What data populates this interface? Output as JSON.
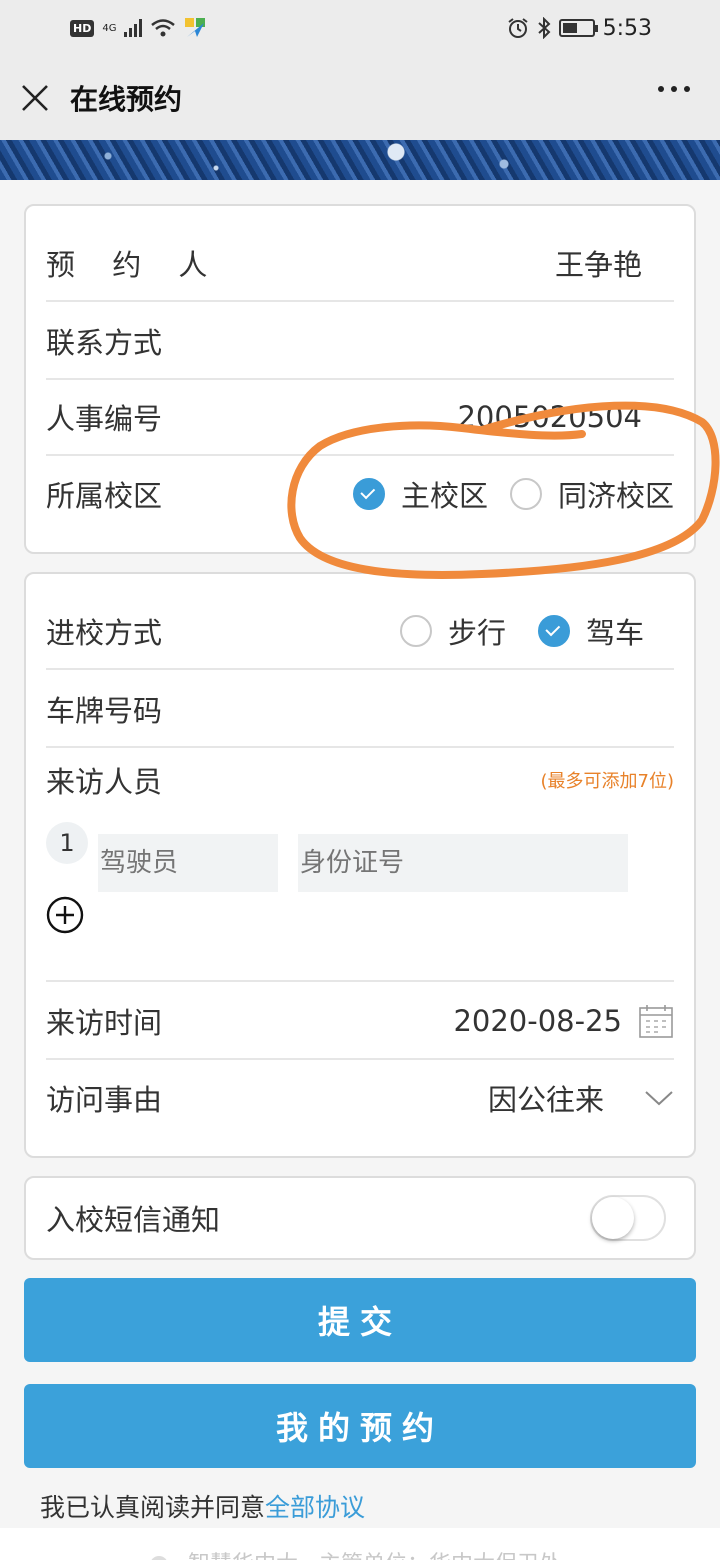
{
  "status_bar": {
    "hd": "HD",
    "net": "4G",
    "time": "5:53"
  },
  "header": {
    "title": "在线预约",
    "close_icon": "close-icon",
    "more_icon": "more-dots-icon"
  },
  "card1": {
    "booker_label": "预 约 人",
    "booker_value": "王争艳",
    "contact_label": "联系方式",
    "contact_value": "",
    "staff_id_label": "人事编号",
    "staff_id_value": "2005020504",
    "campus_label": "所属校区",
    "campus_options": [
      {
        "label": "主校区",
        "selected": true
      },
      {
        "label": "同济校区",
        "selected": false
      }
    ]
  },
  "card2": {
    "entry_label": "进校方式",
    "entry_options": [
      {
        "label": "步行",
        "selected": false
      },
      {
        "label": "驾车",
        "selected": true
      }
    ],
    "plate_label": "车牌号码",
    "visitors_label": "来访人员",
    "visitors_hint": "(最多可添加7位)",
    "visitor_index": "1",
    "driver_placeholder": "驾驶员",
    "id_placeholder": "身份证号",
    "visit_time_label": "来访时间",
    "visit_time_value": "2020-08-25",
    "reason_label": "访问事由",
    "reason_value": "因公往来"
  },
  "sms": {
    "label": "入校短信通知",
    "enabled": false
  },
  "buttons": {
    "submit": "提交",
    "my_bookings": "我的预约"
  },
  "agreement": {
    "text": "我已认真阅读并同意",
    "link": "全部协议"
  },
  "footer": {
    "text": "智慧华中大 · 主管单位：华中大保卫处"
  },
  "colors": {
    "accent": "#3ba1da",
    "hint": "#e8822a",
    "annotation": "#f08a3c"
  }
}
